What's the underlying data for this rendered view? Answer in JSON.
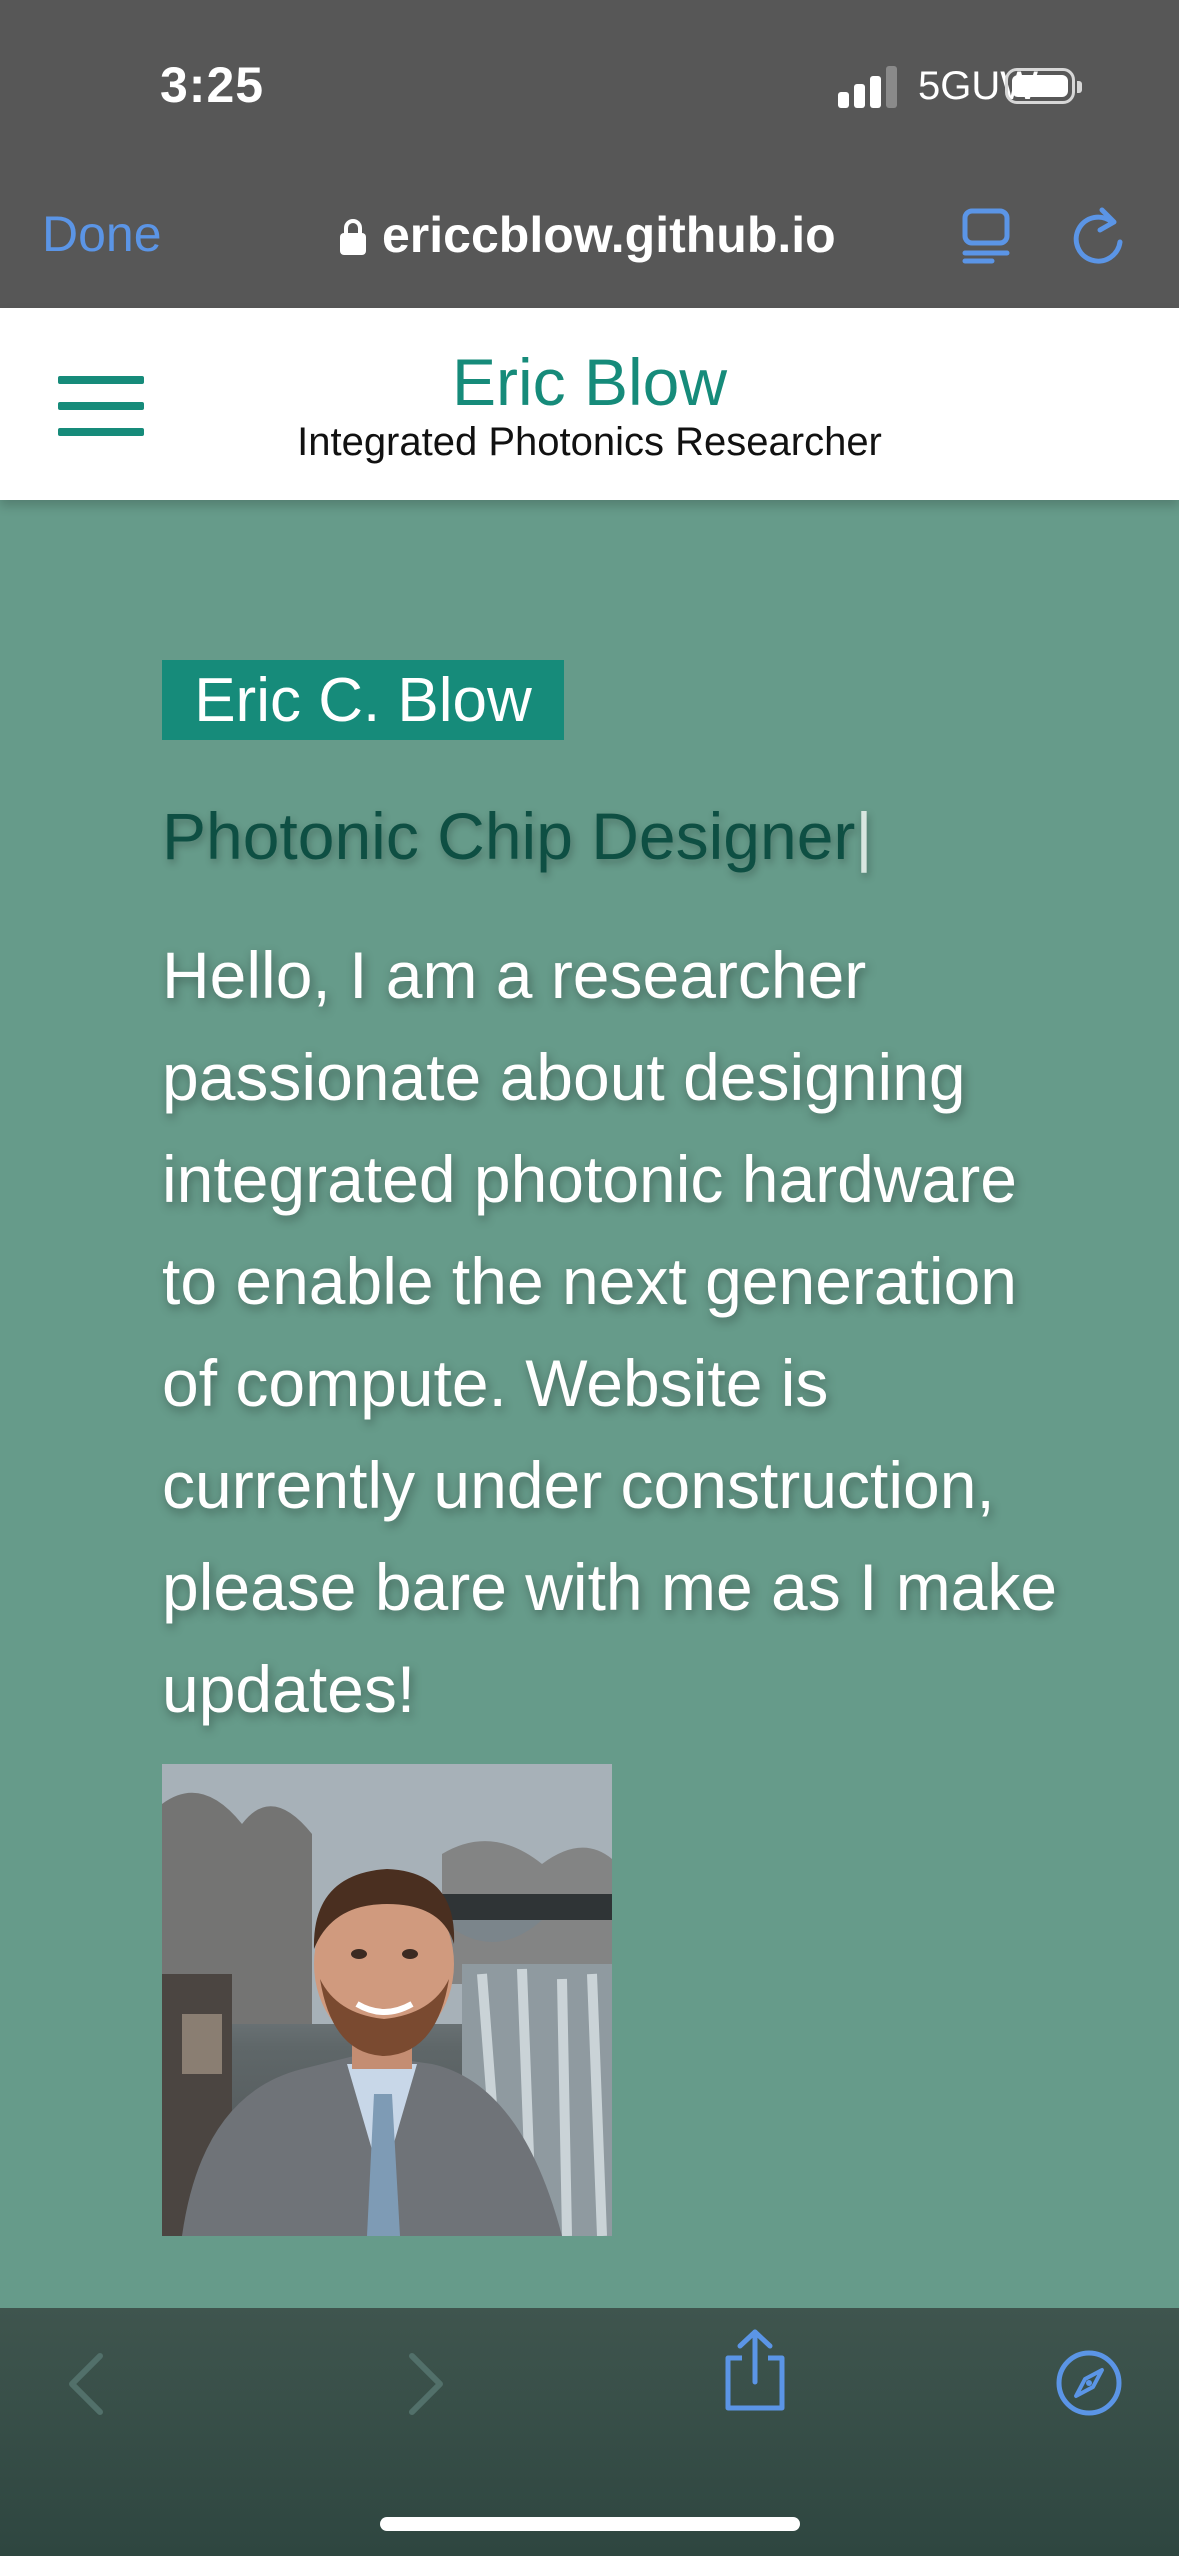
{
  "status_bar": {
    "time": "3:25",
    "network": "5GUW",
    "icons": [
      "signal-bars-icon",
      "battery-icon"
    ]
  },
  "browser": {
    "done_label": "Done",
    "url": "ericcblow.github.io",
    "icons": [
      "lock-icon",
      "reader-mode-icon",
      "reload-icon",
      "back-icon",
      "forward-icon",
      "share-icon",
      "safari-compass-icon"
    ],
    "accent_color": "#5b95e6"
  },
  "site_header": {
    "name": "Eric Blow",
    "tagline": "Integrated Photonics Researcher",
    "menu_icon": "hamburger-menu-icon",
    "brand_color": "#168b7a"
  },
  "hero": {
    "name_badge": "Eric C. Blow",
    "role": "Photonic Chip Designer",
    "cursor": "|",
    "intro": "Hello, I am a researcher passionate about designing integrated photonic hardware to enable the next generation of compute. Website is currently under construction, please bare with me as I make updates!",
    "background_color": "#669b8a"
  }
}
